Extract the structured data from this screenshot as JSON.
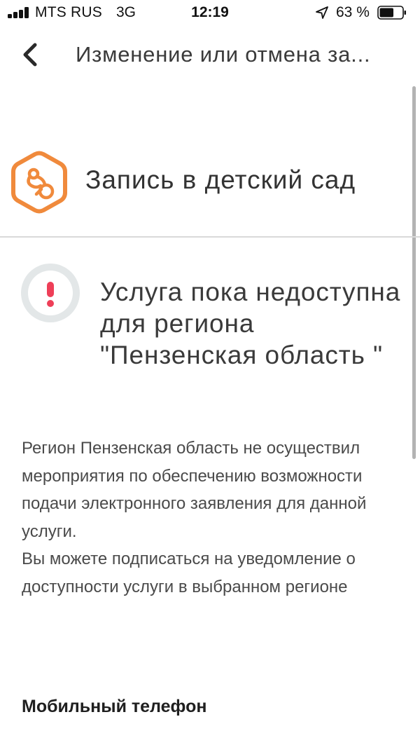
{
  "status_bar": {
    "carrier": "MTS RUS",
    "network": "3G",
    "time": "12:19",
    "battery_percent": "63 %",
    "battery_level": 0.63,
    "location_icon": "location-arrow-icon"
  },
  "header": {
    "back_icon": "chevron-left-icon",
    "title": "Изменение или отмена за..."
  },
  "service": {
    "icon": "pacifier-hexagon-icon",
    "title": "Запись в детский сад",
    "accent_color": "#f08a3c"
  },
  "alert": {
    "icon": "exclamation-icon",
    "title": "Услуга пока недоступна для региона \"Пензенская область \"",
    "accent_color": "#ee3f58"
  },
  "description": {
    "paragraph1": "Регион Пензенская область не осуществил мероприятия по обеспечению возможности подачи электронного заявления для данной услуги.",
    "paragraph2": "Вы можете подписаться на уведомление о доступности услуги в выбранном регионе"
  },
  "form": {
    "phone_label": "Мобильный телефон"
  }
}
